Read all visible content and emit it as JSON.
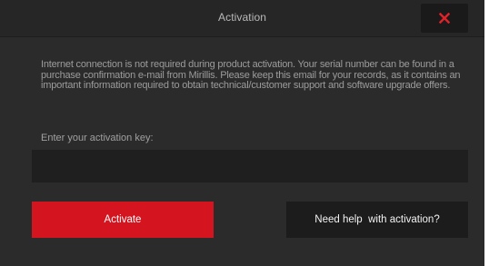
{
  "window": {
    "title": "Activation",
    "close_icon": "close-icon",
    "close_color": "#e0222b"
  },
  "main": {
    "description": "Internet connection is not required during product activation. Your serial number can be found in a purchase confirmation e-mail from Mirillis. Please keep this email for your records, as it contains an important information required to obtain technical/customer support and software  upgrade offers.",
    "key_label": "Enter your activation key:",
    "key_value": "",
    "key_placeholder": ""
  },
  "buttons": {
    "activate_label": "Activate",
    "help_label": "Need help  with activation?"
  },
  "colors": {
    "background": "#2b2b2b",
    "accent": "#d4141e"
  }
}
